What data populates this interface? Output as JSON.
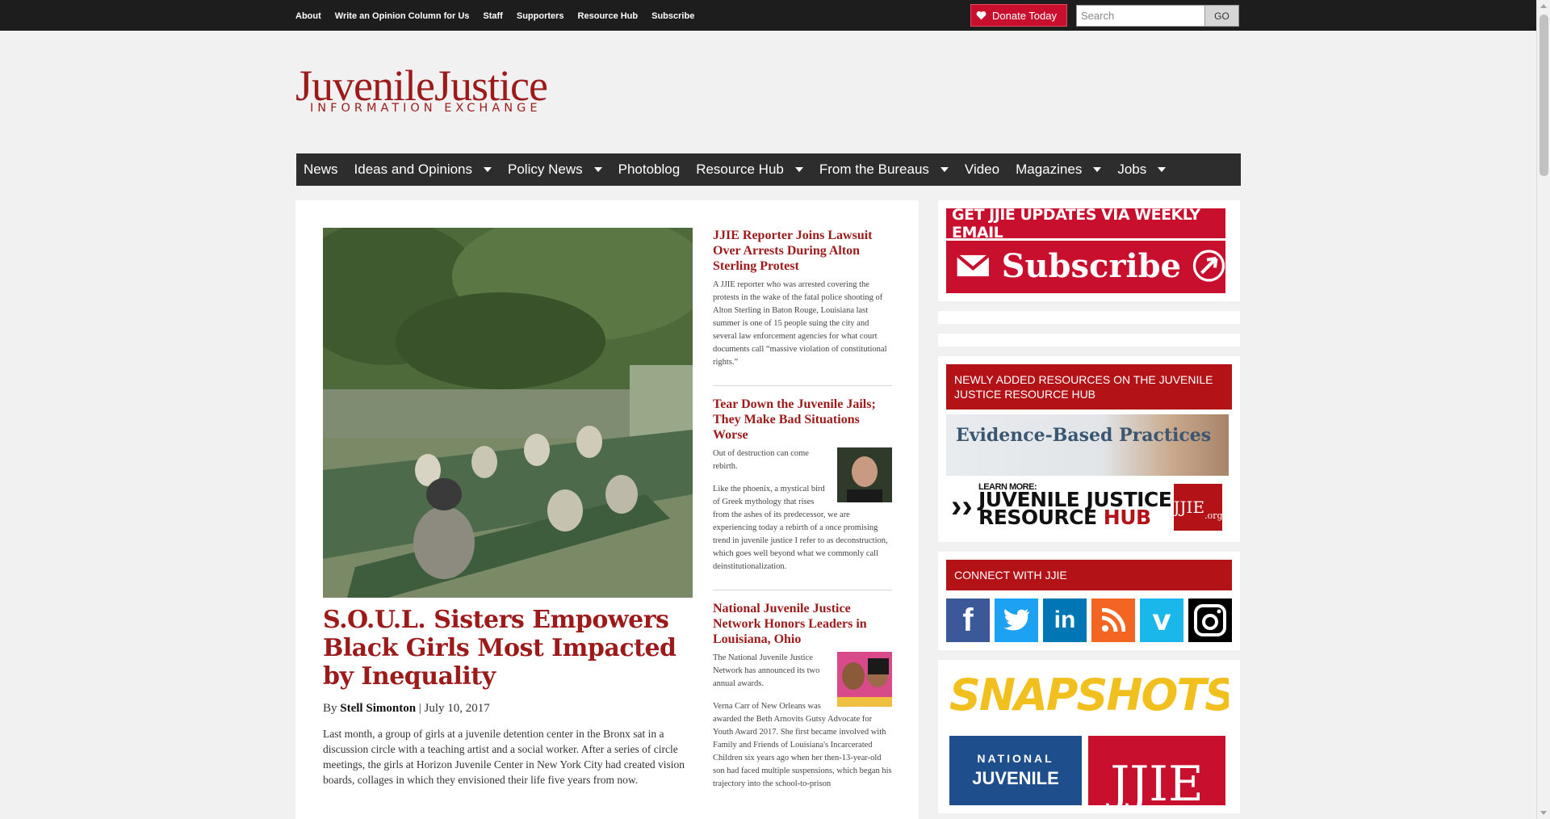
{
  "top_nav": {
    "links": [
      "About",
      "Write an Opinion Column for Us",
      "Staff",
      "Supporters",
      "Resource Hub",
      "Subscribe"
    ],
    "donate_label": "Donate Today",
    "search_placeholder": "Search",
    "go_label": "GO"
  },
  "logo": {
    "main": "JuvenileJustice",
    "sub": "INFORMATION EXCHANGE"
  },
  "main_nav": [
    {
      "label": "News",
      "dropdown": false
    },
    {
      "label": "Ideas and Opinions",
      "dropdown": true
    },
    {
      "label": "Policy News",
      "dropdown": true
    },
    {
      "label": "Photoblog",
      "dropdown": false
    },
    {
      "label": "Resource Hub",
      "dropdown": true
    },
    {
      "label": "From the Bureaus",
      "dropdown": true
    },
    {
      "label": "Video",
      "dropdown": false
    },
    {
      "label": "Magazines",
      "dropdown": true
    },
    {
      "label": "Jobs",
      "dropdown": true
    }
  ],
  "featured": {
    "headline": "S.O.U.L. Sisters Empowers Black Girls Most Impacted by Inequality",
    "by": "By",
    "author": "Stell Simonton",
    "date": "| July 10, 2017",
    "excerpt": "Last month, a group of girls at a juvenile detention center in the Bronx sat in a discussion circle with a teaching artist and a social worker. After a series of circle meetings, the girls at Horizon Juvenile Center in New York City had created vision boards, collages in which they envisioned their life five years from now."
  },
  "stories": [
    {
      "title": "JJIE Reporter Joins Lawsuit Over Arrests During Alton Sterling Protest",
      "paragraphs": [
        "A JJIE reporter who was arrested covering the protests in the wake of the fatal police shooting of Alton Sterling in Baton Rouge, Louisiana last summer is one of 15 people suing the city and several law enforcement agencies for what court documents call “massive violation of constitutional rights.”"
      ]
    },
    {
      "title": "Tear Down the Juvenile Jails; They Make Bad Situations Worse",
      "paragraphs": [
        "Out of destruction can come rebirth.",
        "Like the phoenix, a mystical bird of Greek mythology that rises from the ashes of its predecessor, we are experiencing today a rebirth of a once promising trend in juvenile justice I refer to as deconstruction, which goes well beyond what we commonly call deinstitutionalization."
      ]
    },
    {
      "title": "National Juvenile Justice Network Honors Leaders in Louisiana, Ohio",
      "paragraphs": [
        "The National Juvenile Justice Network has announced its two annual awards.",
        "Verna Carr of New Orleans was awarded the Beth Arnovits Gutsy Advocate for Youth Award 2017. She first became involved with Family and Friends of Louisiana's Incarcerated Children six years ago when her then-13-year-old son had faced multiple suspensions, which began his trajectory into the school-to-prison"
      ]
    }
  ],
  "sidebar": {
    "email_top": "GET JJIE UPDATES VIA WEEKLY EMAIL",
    "subscribe": "Subscribe",
    "resources_header": "NEWLY ADDED RESOURCES ON THE JUVENILE JUSTICE RESOURCE HUB",
    "resource1": "Evidence-Based Practices",
    "learn_more": "LEARN MORE:",
    "jj_line1": "JUVENILE JUSTICE",
    "jj_line2a": "RESOURCE ",
    "jj_line2b": "HUB",
    "jjie_badge": "JJIE",
    "jjie_badge_sub": ".org",
    "connect_header": "CONNECT WITH JJIE",
    "snapshots": "SNAPSHOTS",
    "snap_national": "NATIONAL",
    "snap_juvenile": "JUVENILE",
    "snap_jjie": "JJIE"
  },
  "social": [
    {
      "name": "facebook-icon",
      "glyph": "f",
      "color": "#3b5998"
    },
    {
      "name": "twitter-icon",
      "glyph": "",
      "color": "#1da1f2"
    },
    {
      "name": "linkedin-icon",
      "glyph": "in",
      "color": "#0077b5"
    },
    {
      "name": "rss-icon",
      "glyph": "",
      "color": "#f26522"
    },
    {
      "name": "vimeo-icon",
      "glyph": "v",
      "color": "#1ab7ea"
    },
    {
      "name": "instagram-icon",
      "glyph": "",
      "color": "#000000"
    }
  ]
}
